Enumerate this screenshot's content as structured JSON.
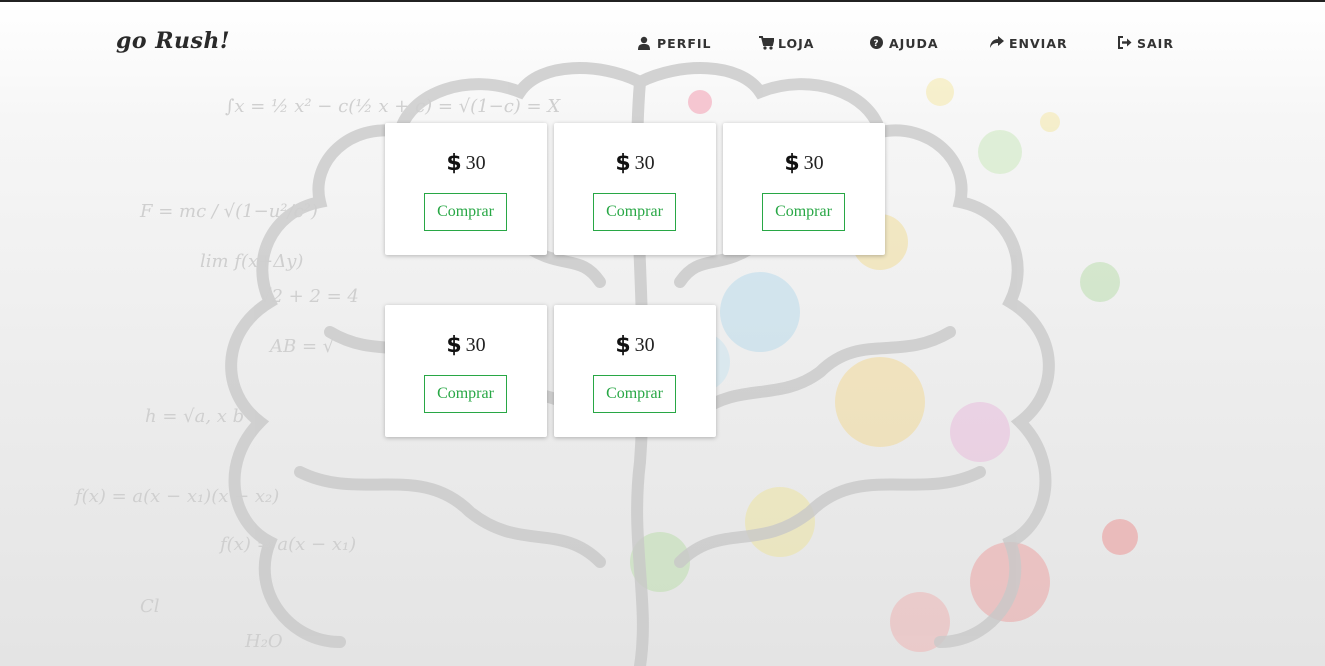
{
  "brand": "go Rush!",
  "nav": {
    "items": [
      {
        "label": "PERFIL",
        "icon": "user-icon"
      },
      {
        "label": "LOJA",
        "icon": "cart-icon"
      },
      {
        "label": "AJUDA",
        "icon": "question-circle-icon"
      },
      {
        "label": "ENVIAR",
        "icon": "share-icon"
      },
      {
        "label": "SAIR",
        "icon": "sign-out-icon"
      }
    ]
  },
  "store": {
    "items": [
      {
        "price": "30",
        "button": "Comprar"
      },
      {
        "price": "30",
        "button": "Comprar"
      },
      {
        "price": "30",
        "button": "Comprar"
      },
      {
        "price": "30",
        "button": "Comprar"
      },
      {
        "price": "30",
        "button": "Comprar"
      }
    ],
    "currency_icon": "dollar-icon"
  },
  "colors": {
    "accent": "#28a745",
    "text": "#333333"
  }
}
